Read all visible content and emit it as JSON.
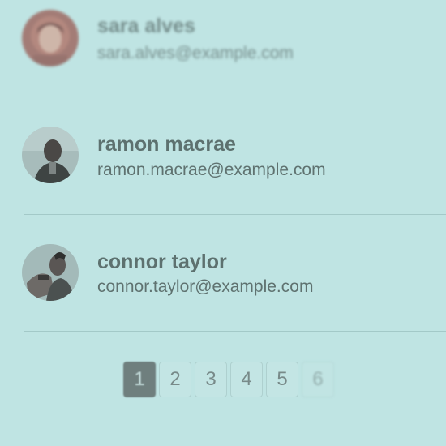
{
  "users": [
    {
      "name": "sara alves",
      "email": "sara.alves@example.com",
      "avatar_icon": "user-photo-icon"
    },
    {
      "name": "ramon macrae",
      "email": "ramon.macrae@example.com",
      "avatar_icon": "user-photo-icon"
    },
    {
      "name": "connor taylor",
      "email": "connor.taylor@example.com",
      "avatar_icon": "user-photo-icon"
    }
  ],
  "pagination": {
    "pages": [
      "1",
      "2",
      "3",
      "4",
      "5",
      "6"
    ],
    "current": "1"
  },
  "colors": {
    "background": "#bfe4e3",
    "text": "#5d716f",
    "active_page": "#6f7f7e"
  }
}
